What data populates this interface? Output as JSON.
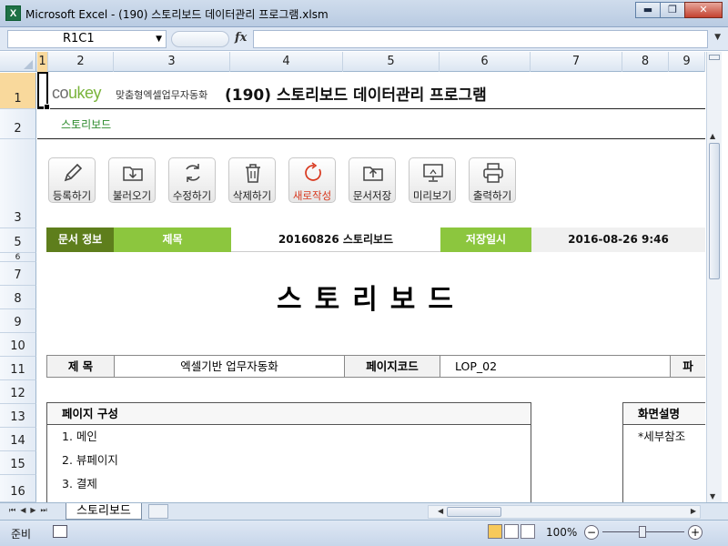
{
  "window": {
    "title": "Microsoft Excel - (190) 스토리보드 데이터관리 프로그램.xlsm",
    "app_icon": "X",
    "controls": {
      "minimize": "▬",
      "restore": "❐",
      "close": "✕"
    }
  },
  "formula_bar": {
    "name_box": "R1C1",
    "fx_label": "fx",
    "formula": ""
  },
  "columns": [
    "1",
    "2",
    "3",
    "4",
    "5",
    "6",
    "7",
    "8",
    "9"
  ],
  "rows": [
    "1",
    "2",
    "3",
    "5",
    "6",
    "7",
    "8",
    "9",
    "10",
    "11",
    "12",
    "13",
    "14",
    "15",
    "16"
  ],
  "header": {
    "logo_co": "co",
    "logo_ukey": "ukey",
    "logo_sub": "맞춤형엑셀업무자동화",
    "title": "(190) 스토리보드 데이터관리 프로그램",
    "sheet_tag": "스토리보드"
  },
  "toolbar": [
    {
      "label": "등록하기",
      "icon": "pencil-icon"
    },
    {
      "label": "불러오기",
      "icon": "folder-download-icon"
    },
    {
      "label": "수정하기",
      "icon": "refresh-icon"
    },
    {
      "label": "삭제하기",
      "icon": "trash-icon"
    },
    {
      "label": "새로작성",
      "icon": "new-doc-icon"
    },
    {
      "label": "문서저장",
      "icon": "folder-upload-icon"
    },
    {
      "label": "미리보기",
      "icon": "monitor-icon"
    },
    {
      "label": "출력하기",
      "icon": "printer-icon"
    }
  ],
  "doc_info": {
    "label": "문서 정보",
    "title_label": "제목",
    "title_value": "20160826 스토리보드",
    "saved_label": "저장일시",
    "saved_value": "2016-08-26 9:46"
  },
  "storyboard_title": "스토리보드",
  "meta": {
    "subject_label": "제  목",
    "subject_value": "엑셀기반 업무자동화",
    "page_code_label": "페이지코드",
    "page_code_value": "LOP_02",
    "cut_label": "파"
  },
  "page_structure": {
    "header": "페이지 구성",
    "items": [
      "1. 메인",
      "2. 뷰페이지",
      "3. 결제"
    ]
  },
  "screen_desc": {
    "header": "화면설명",
    "items": [
      "*세부참조"
    ]
  },
  "sheet_tabs": [
    "스토리보드"
  ],
  "status": {
    "mode": "준비",
    "zoom": "100%"
  }
}
